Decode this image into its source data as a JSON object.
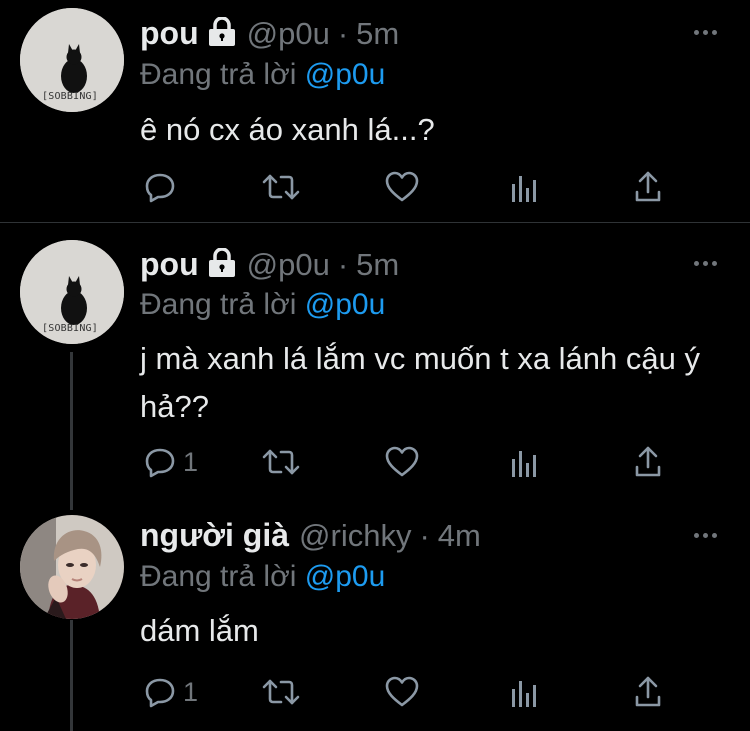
{
  "tweets": [
    {
      "name": "pou",
      "handle": "@p0u",
      "separator": "·",
      "time": "5m",
      "replying_prefix": "Đang trả lời",
      "replying_to": "@p0u",
      "avatar_caption": "[SOBBING]",
      "text": "ê nó cx áo xanh lá...?",
      "reply_count": "",
      "locked": true
    },
    {
      "name": "pou",
      "handle": "@p0u",
      "separator": "·",
      "time": "5m",
      "replying_prefix": "Đang trả lời",
      "replying_to": "@p0u",
      "avatar_caption": "[SOBBING]",
      "text": "j mà xanh lá lắm vc muốn t xa lánh cậu ý hả??",
      "reply_count": "1",
      "locked": true
    },
    {
      "name": "người già",
      "handle": "@richky",
      "separator": "·",
      "time": "4m",
      "replying_prefix": "Đang trả lời",
      "replying_to": "@p0u",
      "text": "dám lắm",
      "reply_count": "1",
      "locked": false
    }
  ],
  "icons": [
    "comment-icon",
    "retweet-icon",
    "like-icon",
    "analytics-icon",
    "share-icon",
    "lock-icon",
    "more-icon"
  ],
  "colors": {
    "background": "#000000",
    "text": "#e7e9ea",
    "muted": "#71767b",
    "mention": "#1d9bf0"
  }
}
